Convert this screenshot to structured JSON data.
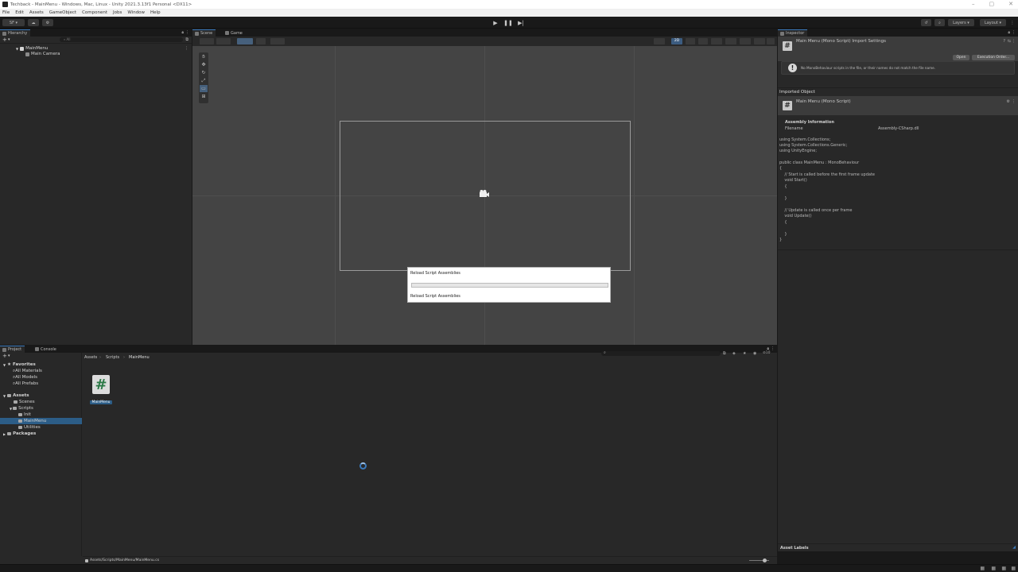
{
  "window": {
    "title": "Techback - MainMenu - Windows, Mac, Linux - Unity 2021.3.13f1 Personal <DX11>"
  },
  "menubar": [
    "File",
    "Edit",
    "Assets",
    "GameObject",
    "Component",
    "Jobs",
    "Window",
    "Help"
  ],
  "toolbar": {
    "account": "SF",
    "layers": "Layers",
    "layout": "Layout"
  },
  "hierarchy": {
    "tab": "Hierarchy",
    "search_placeholder": "All",
    "scene": "MainMenu",
    "items": [
      "Main Camera"
    ]
  },
  "scene_view": {
    "tabs": [
      "Scene",
      "Game"
    ],
    "mode_2d": "2D"
  },
  "dialog": {
    "title": "Reload Script Assemblies",
    "status": "Reload Script Assemblies",
    "progress": 0.0
  },
  "inspector": {
    "tab": "Inspector",
    "header_title": "Main Menu (Mono Script) Import Settings",
    "open_btn": "Open",
    "exec_order_btn": "Execution Order...",
    "warning": "No MonoBehaviour scripts in the file, or their names do not match the file name.",
    "imported_object_label": "Imported Object",
    "object_title": "Main Menu (Mono Script)",
    "assembly_info_label": "Assembly Information",
    "filename_label": "Filename",
    "filename_value": "Assembly-CSharp.dll",
    "code": [
      "using System.Collections;",
      "using System.Collections.Generic;",
      "using UnityEngine;",
      "",
      "public class MainMenu : MonoBehaviour",
      "{",
      "    // Start is called before the first frame update",
      "    void Start()",
      "    {",
      "",
      "    }",
      "",
      "    // Update is called once per frame",
      "    void Update()",
      "    {",
      "",
      "    }",
      "}"
    ],
    "asset_labels": "Asset Labels"
  },
  "project": {
    "tabs": [
      "Project",
      "Console"
    ],
    "favorites": "Favorites",
    "fav_items": [
      "All Materials",
      "All Models",
      "All Prefabs"
    ],
    "assets": "Assets",
    "tree": [
      "Scenes",
      "Scripts",
      "Init",
      "MainMenu",
      "Utilities"
    ],
    "packages": "Packages",
    "breadcrumb": [
      "Assets",
      "Scripts",
      "MainMenu"
    ],
    "file_name": "MainMenu",
    "badge_count": "10",
    "status_path": "Assets/Scripts/MainMenu/MainMenu.cs"
  }
}
